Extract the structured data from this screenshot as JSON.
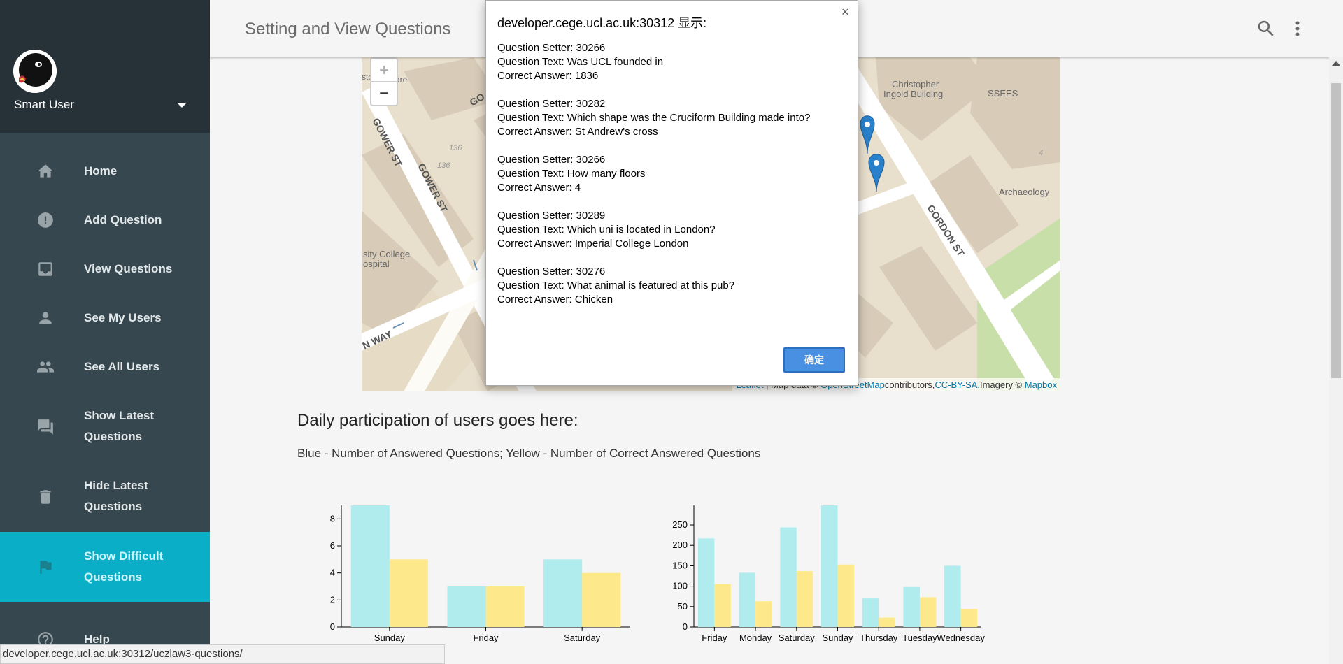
{
  "sidebar": {
    "user_name": "Smart User",
    "items": [
      {
        "label": "Home",
        "icon": "home-icon"
      },
      {
        "label": "Add Question",
        "icon": "alert-circle-icon"
      },
      {
        "label": "View Questions",
        "icon": "inbox-icon"
      },
      {
        "label": "See My Users",
        "icon": "person-icon"
      },
      {
        "label": "See All Users",
        "icon": "people-icon"
      },
      {
        "label": "Show Latest Questions",
        "icon": "forum-icon"
      },
      {
        "label": "Hide Latest Questions",
        "icon": "trash-icon"
      },
      {
        "label": "Show Difficult Questions",
        "icon": "flag-icon",
        "active": true
      },
      {
        "label": "Help",
        "icon": "help-icon"
      }
    ]
  },
  "header": {
    "title": "Setting and View Questions"
  },
  "map": {
    "zoom_in": "+",
    "zoom_out": "−",
    "labels": {
      "gower_st_1": "GOWER ST",
      "gower_st_2": "GOWER ST",
      "n_way": "N WAY",
      "sity_college": "sity College",
      "ospital": "ospital",
      "christopher": "Christopher",
      "ingold": "Ingold Building",
      "ssees": "SSEES",
      "archaeology": "Archaeology",
      "gordon_st": "GORDON ST",
      "n136a": "136",
      "n136b": "136",
      "n4": "4",
      "sto": "sto",
      "are": "are",
      "go": "GO"
    },
    "attribution": {
      "leaflet": "Leaflet",
      "text1": " | Map data © ",
      "osm": "OpenStreetMap",
      "text2": "contributors,",
      "ccbysa": "CC-BY-SA",
      "text3": ",Imagery © ",
      "mapbox": "Mapbox"
    },
    "colors": {
      "marker": "#2a81cb",
      "building": "#d9cfc0",
      "road": "#ffffff",
      "park": "#cfe3b4"
    }
  },
  "main": {
    "heading": "Daily participation of users goes here:",
    "legend": "Blue - Number of Answered Questions; Yellow - Number of Correct Answered Questions"
  },
  "chart_data": [
    {
      "type": "bar",
      "categories": [
        "Sunday",
        "Friday",
        "Saturday"
      ],
      "series": [
        {
          "values": [
            9,
            3,
            5
          ],
          "color": "#b0ebee"
        },
        {
          "values": [
            5,
            3,
            4
          ],
          "color": "#fde98c"
        }
      ],
      "ylim": [
        0,
        9
      ],
      "yticks": [
        0,
        2,
        4,
        6,
        8
      ]
    },
    {
      "type": "bar",
      "categories": [
        "Friday",
        "Monday",
        "Saturday",
        "Sunday",
        "Thursday",
        "Tuesday",
        "Wednesday"
      ],
      "series": [
        {
          "values": [
            217,
            133,
            244,
            298,
            70,
            98,
            150
          ],
          "color": "#b0ebee"
        },
        {
          "values": [
            105,
            63,
            137,
            153,
            23,
            73,
            44
          ],
          "color": "#fde98c"
        }
      ],
      "ylim": [
        0,
        298
      ],
      "yticks": [
        0,
        50,
        100,
        150,
        200,
        250
      ]
    }
  ],
  "dialog": {
    "title": "developer.cege.ucl.ac.uk:30312 显示:",
    "close": "×",
    "ok_label": "确定",
    "questions": [
      {
        "setter": "Question Setter: 30266",
        "text": "Question Text: Was UCL founded in",
        "answer": "Correct Answer: 1836"
      },
      {
        "setter": "Question Setter: 30282",
        "text": "Question Text: Which shape was the Cruciform Building made into?",
        "answer": "Correct Answer: St Andrew's cross"
      },
      {
        "setter": "Question Setter: 30266",
        "text": "Question Text: How many floors",
        "answer": "Correct Answer: 4"
      },
      {
        "setter": "Question Setter: 30289",
        "text": "Question Text: Which uni is located in London?",
        "answer": "Correct Answer: Imperial College London"
      },
      {
        "setter": "Question Setter: 30276",
        "text": "Question Text: What animal is featured at this pub?",
        "answer": "Correct Answer: Chicken"
      }
    ]
  },
  "status_bar": {
    "url": "developer.cege.ucl.ac.uk:30312/uczlaw3-questions/"
  }
}
